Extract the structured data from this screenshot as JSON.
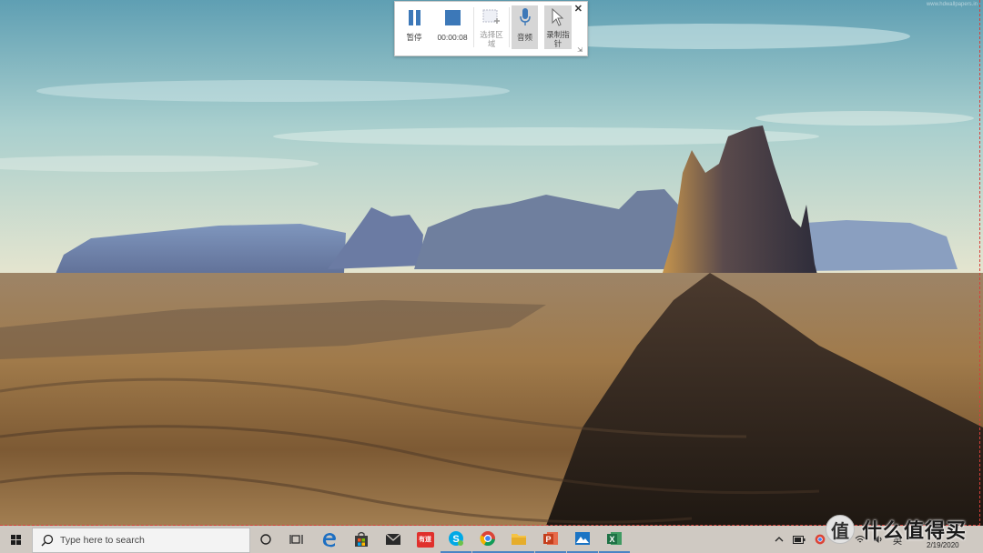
{
  "wallpaper": {
    "watermark": "www.hdwallpapers.in"
  },
  "recorder": {
    "pause_label": "暂停",
    "timer": "00:00:08",
    "select_area_label": "选择区域",
    "audio_label": "音频",
    "record_pointer_label": "录制指针",
    "close_symbol": "✕",
    "pin_symbol": "⇲",
    "accent": "#3c78b8"
  },
  "taskbar": {
    "search_placeholder": "Type here to search",
    "apps": [
      "task-view",
      "task-switcher",
      "edge",
      "store",
      "mail",
      "netease-news",
      "skype",
      "chrome",
      "file-explorer",
      "powerpoint",
      "photos",
      "excel"
    ],
    "youdao_label": "有道",
    "tray": {
      "ime": "英",
      "date": "2/19/2020"
    }
  },
  "watermark_brand": {
    "symbol": "值",
    "text": "什么值得买"
  }
}
